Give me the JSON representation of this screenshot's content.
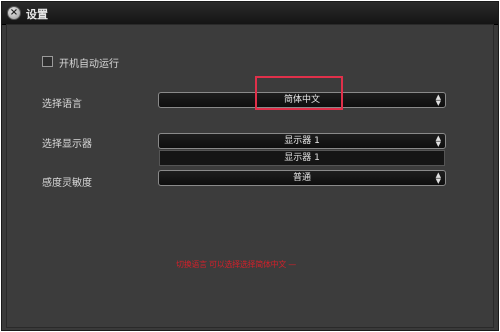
{
  "window": {
    "title": "设置"
  },
  "options": {
    "autostart_label": "开机自动运行",
    "language_label": "选择语言",
    "language_value": "简体中文",
    "display_label": "选择显示器",
    "display_value": "显示器 1",
    "display_dropdown_option": "显示器 1",
    "sharpness_label": "感度灵敏度",
    "sharpness_value": "普通"
  },
  "annotation": {
    "caption": "切换语言 可以选择选择简体中文 —",
    "highlight_color": "#e0304a"
  }
}
